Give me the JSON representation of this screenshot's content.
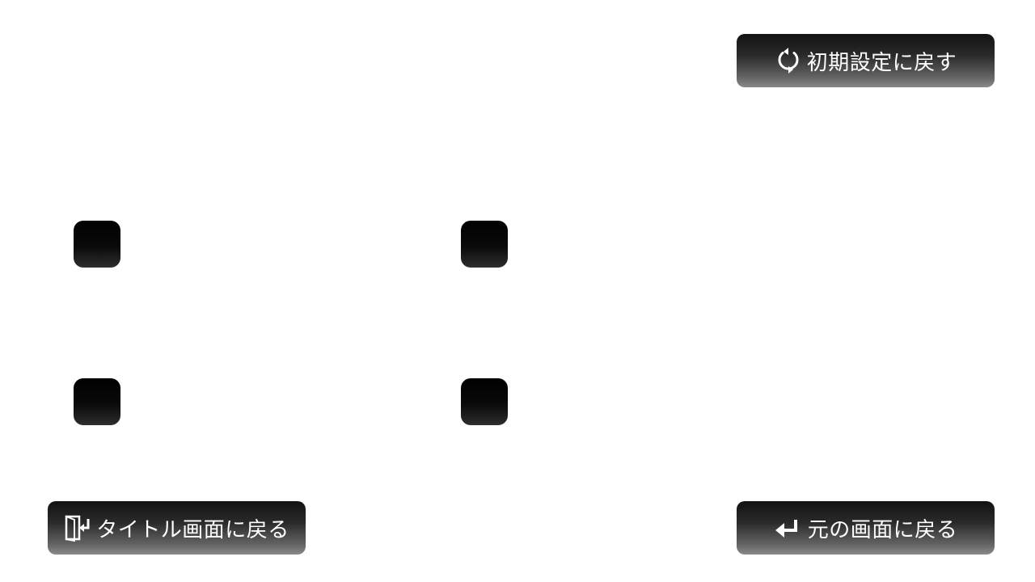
{
  "buttons": {
    "reset": {
      "label": "初期設定に戻す",
      "icon": "refresh-icon"
    },
    "title_screen": {
      "label": "タイトル画面に戻る",
      "icon": "exit-door-icon"
    },
    "back": {
      "label": "元の画面に戻る",
      "icon": "return-arrow-icon"
    }
  },
  "options": [
    {
      "icon": "checkbox",
      "checked": false
    },
    {
      "icon": "checkbox",
      "checked": false
    },
    {
      "icon": "checkbox",
      "checked": false
    },
    {
      "icon": "checkbox",
      "checked": false
    }
  ],
  "colors": {
    "background": "#ffffff",
    "button_top": "#121212",
    "button_bottom": "#8a8a8a",
    "text": "#ffffff"
  }
}
